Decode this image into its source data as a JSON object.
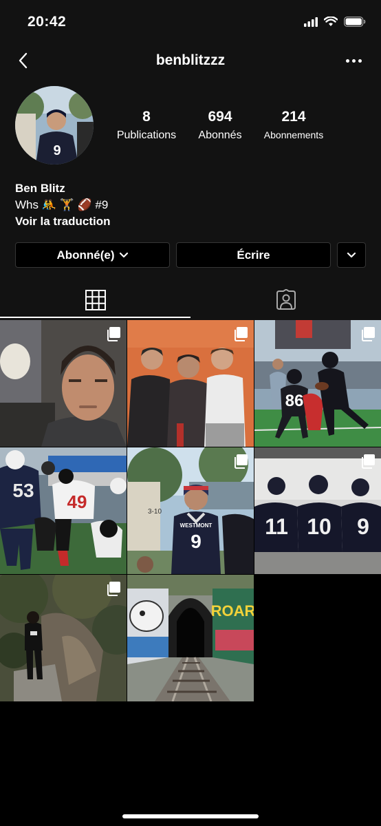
{
  "status_bar": {
    "time": "20:42",
    "icons": [
      "signal-icon",
      "wifi-icon",
      "battery-icon"
    ]
  },
  "nav": {
    "title": "benblitzzz",
    "back_icon": "chevron-left-icon",
    "more_icon": "more-horizontal-icon"
  },
  "profile": {
    "stats": [
      {
        "value": "8",
        "label": "Publications"
      },
      {
        "value": "694",
        "label": "Abonnés"
      },
      {
        "value": "214",
        "label": "Abonnements"
      }
    ],
    "name": "Ben Blitz",
    "bio": "Whs 🤼 🏋 🏈 #9",
    "translate": "Voir la traduction"
  },
  "actions": {
    "follow_label": "Abonné(e)",
    "message_label": "Écrire"
  },
  "tabs": [
    {
      "name": "grid",
      "icon": "grid-icon",
      "active": true
    },
    {
      "name": "tagged",
      "icon": "tagged-person-icon",
      "active": false
    }
  ],
  "posts": [
    {
      "id": "post-1",
      "multi": true,
      "subject": "selfie"
    },
    {
      "id": "post-2",
      "multi": true,
      "subject": "three friends"
    },
    {
      "id": "post-3",
      "multi": true,
      "subject": "football play",
      "jersey": "86"
    },
    {
      "id": "post-4",
      "multi": false,
      "subject": "football tackle",
      "jerseys": [
        "53",
        "49"
      ]
    },
    {
      "id": "post-5",
      "multi": true,
      "subject": "player portrait",
      "jersey": "9",
      "text": "WESTMONT"
    },
    {
      "id": "post-6",
      "multi": true,
      "subject": "team backs",
      "jerseys": [
        "11",
        "10",
        "9"
      ]
    },
    {
      "id": "post-7",
      "multi": true,
      "subject": "cliff"
    },
    {
      "id": "post-8",
      "multi": false,
      "subject": "graffiti tunnel",
      "text": "ROAR"
    }
  ],
  "colors": {
    "background": "#121212",
    "button_border": "#363636"
  }
}
